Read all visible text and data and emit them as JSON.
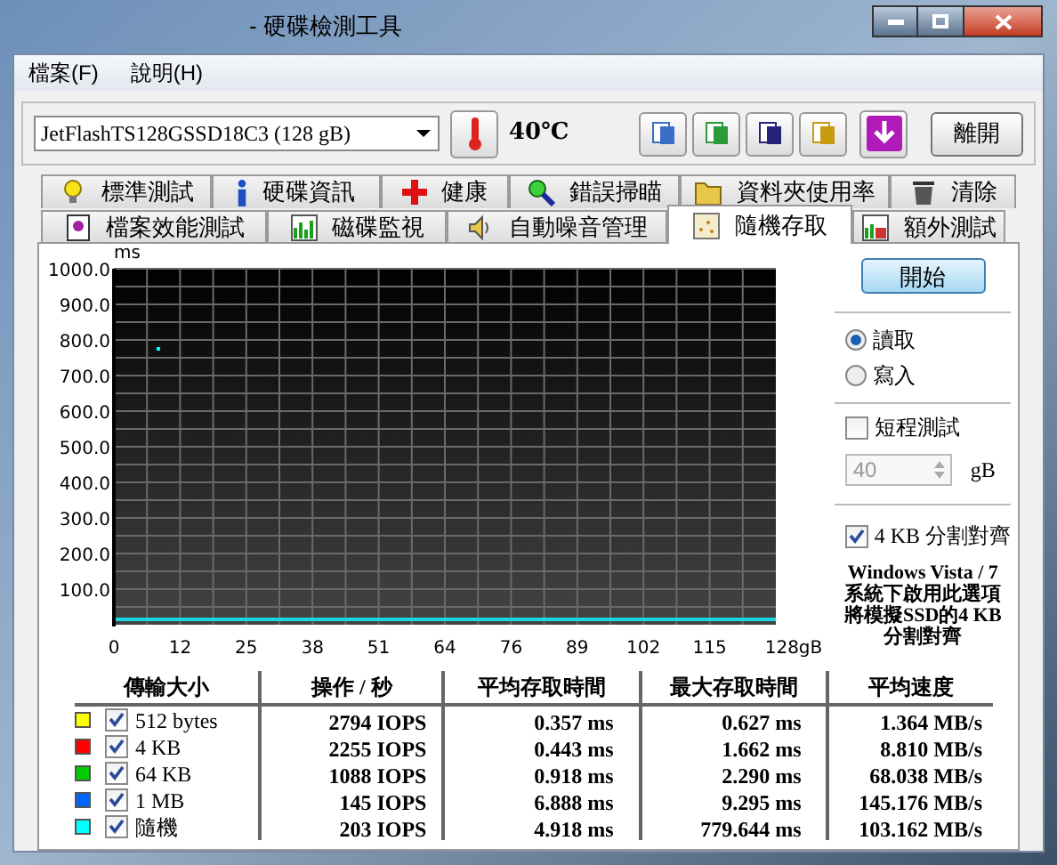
{
  "window": {
    "title": "- 硬碟檢測工具"
  },
  "menu": [
    {
      "label": "檔案(F)"
    },
    {
      "label": "說明(H)"
    }
  ],
  "drive": {
    "value": "JetFlashTS128GSSD18C3 (128 gB)"
  },
  "temperature": "40℃",
  "exit_button": "離開",
  "tabs_row_1": [
    {
      "label": "標準測試",
      "selected": false
    },
    {
      "label": "硬碟資訊",
      "selected": false
    },
    {
      "label": "健康",
      "selected": false
    },
    {
      "label": "錯誤掃瞄",
      "selected": false
    },
    {
      "label": "資料夾使用率",
      "selected": false
    },
    {
      "label": "清除",
      "selected": false
    }
  ],
  "tabs_row_2": [
    {
      "label": "檔案效能測試",
      "selected": false
    },
    {
      "label": "磁碟監視",
      "selected": false
    },
    {
      "label": "自動噪音管理",
      "selected": false
    },
    {
      "label": "隨機存取",
      "selected": true
    },
    {
      "label": "額外測試",
      "selected": false
    }
  ],
  "chart": {
    "unit": "ms",
    "y_ticks": [
      "1000.0",
      "900.0",
      "800.0",
      "700.0",
      "600.0",
      "500.0",
      "400.0",
      "300.0",
      "200.0",
      "100.0"
    ],
    "x_ticks": [
      "0",
      "12",
      "25",
      "38",
      "51",
      "64",
      "76",
      "89",
      "102",
      "115",
      "128gB"
    ]
  },
  "start_button": "開始",
  "modes": [
    {
      "label": "讀取",
      "selected": true
    },
    {
      "label": "寫入",
      "selected": false
    }
  ],
  "short_test": {
    "label": "短程測試",
    "checked": false
  },
  "short_test_size": {
    "value": "40",
    "unit": "gB",
    "disabled": true
  },
  "alignment": {
    "label": "4 KB 分割對齊",
    "checked": true
  },
  "note_lines": [
    "Windows Vista / 7",
    "系統下啟用此選項",
    "將模擬SSD的4 KB",
    "分割對齊"
  ],
  "table": {
    "columns": [
      "傳輸大小",
      "操作 / 秒",
      "平均存取時間",
      "最大存取時間",
      "平均速度"
    ],
    "rows": [
      {
        "color": "#ffff00",
        "checked": true,
        "label": "512 bytes",
        "ops": "2794 IOPS",
        "avg": "0.357 ms",
        "max": "0.627 ms",
        "speed": "1.364 MB/s"
      },
      {
        "color": "#ff0000",
        "checked": true,
        "label": "4 KB",
        "ops": "2255 IOPS",
        "avg": "0.443 ms",
        "max": "1.662 ms",
        "speed": "8.810 MB/s"
      },
      {
        "color": "#00cc00",
        "checked": true,
        "label": "64 KB",
        "ops": "1088 IOPS",
        "avg": "0.918 ms",
        "max": "2.290 ms",
        "speed": "68.038 MB/s"
      },
      {
        "color": "#0066ff",
        "checked": true,
        "label": "1 MB",
        "ops": "145 IOPS",
        "avg": "6.888 ms",
        "max": "9.295 ms",
        "speed": "145.176 MB/s"
      },
      {
        "color": "#00ffff",
        "checked": true,
        "label": "隨機",
        "ops": "203 IOPS",
        "avg": "4.918 ms",
        "max": "779.644 ms",
        "speed": "103.162 MB/s"
      }
    ]
  }
}
